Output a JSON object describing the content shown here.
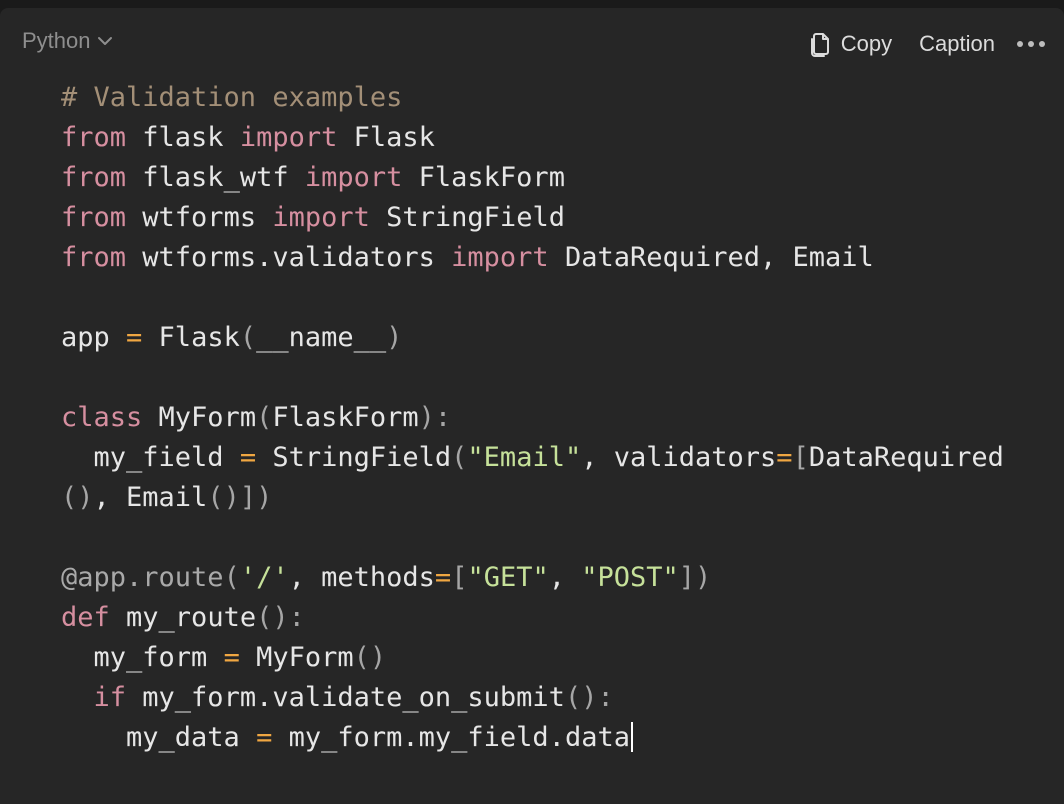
{
  "header": {
    "language": "Python",
    "copy_label": "Copy",
    "caption_label": "Caption"
  },
  "icons": {
    "language_dropdown": "chevron-down-icon",
    "copy": "copy-icon",
    "more": "more-options-icon"
  },
  "colors": {
    "background": "#262626",
    "keyword": "#d68fa0",
    "comment": "#a38f77",
    "operator": "#f0a742",
    "string": "#c6e19a",
    "text": "#e6e6e6"
  },
  "code": {
    "lines": [
      [
        {
          "t": "# Validation examples",
          "c": "cm"
        }
      ],
      [
        {
          "t": "from",
          "c": "kw"
        },
        {
          "t": " flask "
        },
        {
          "t": "import",
          "c": "kw"
        },
        {
          "t": " Flask"
        }
      ],
      [
        {
          "t": "from",
          "c": "kw"
        },
        {
          "t": " flask_wtf "
        },
        {
          "t": "import",
          "c": "kw"
        },
        {
          "t": " FlaskForm"
        }
      ],
      [
        {
          "t": "from",
          "c": "kw"
        },
        {
          "t": " wtforms "
        },
        {
          "t": "import",
          "c": "kw"
        },
        {
          "t": " StringField"
        }
      ],
      [
        {
          "t": "from",
          "c": "kw"
        },
        {
          "t": " wtforms.validators "
        },
        {
          "t": "import",
          "c": "kw"
        },
        {
          "t": " DataRequired, Email"
        }
      ],
      [],
      [
        {
          "t": "app "
        },
        {
          "t": "=",
          "c": "op"
        },
        {
          "t": " Flask"
        },
        {
          "t": "(",
          "c": "pu"
        },
        {
          "t": "__name__"
        },
        {
          "t": ")",
          "c": "pu"
        }
      ],
      [],
      [
        {
          "t": "class",
          "c": "kw"
        },
        {
          "t": " MyForm"
        },
        {
          "t": "(",
          "c": "pu"
        },
        {
          "t": "FlaskForm"
        },
        {
          "t": "):",
          "c": "pu"
        }
      ],
      [
        {
          "t": "  my_field "
        },
        {
          "t": "=",
          "c": "op"
        },
        {
          "t": " StringField"
        },
        {
          "t": "(",
          "c": "pu"
        },
        {
          "t": "\"Email\"",
          "c": "str"
        },
        {
          "t": ", validators"
        },
        {
          "t": "=",
          "c": "op"
        },
        {
          "t": "[",
          "c": "pu"
        },
        {
          "t": "DataRequired"
        }
      ],
      [
        {
          "t": "()",
          "c": "pu"
        },
        {
          "t": ", Email"
        },
        {
          "t": "()])",
          "c": "pu"
        }
      ],
      [],
      [
        {
          "t": "@app.",
          "c": "dim"
        },
        {
          "t": "route",
          "c": "dim"
        },
        {
          "t": "(",
          "c": "pu"
        },
        {
          "t": "'/'",
          "c": "str"
        },
        {
          "t": ", methods"
        },
        {
          "t": "=",
          "c": "op"
        },
        {
          "t": "[",
          "c": "pu"
        },
        {
          "t": "\"GET\"",
          "c": "str"
        },
        {
          "t": ", "
        },
        {
          "t": "\"POST\"",
          "c": "str"
        },
        {
          "t": "])",
          "c": "pu"
        }
      ],
      [
        {
          "t": "def",
          "c": "kw"
        },
        {
          "t": " my_route"
        },
        {
          "t": "():",
          "c": "pu"
        }
      ],
      [
        {
          "t": "  my_form "
        },
        {
          "t": "=",
          "c": "op"
        },
        {
          "t": " MyForm"
        },
        {
          "t": "()",
          "c": "pu"
        }
      ],
      [
        {
          "t": "  "
        },
        {
          "t": "if",
          "c": "kw"
        },
        {
          "t": " my_form.validate_on_submit"
        },
        {
          "t": "():",
          "c": "pu"
        }
      ],
      [
        {
          "t": "    my_data "
        },
        {
          "t": "=",
          "c": "op"
        },
        {
          "t": " my_form.my_field.data"
        }
      ]
    ]
  }
}
